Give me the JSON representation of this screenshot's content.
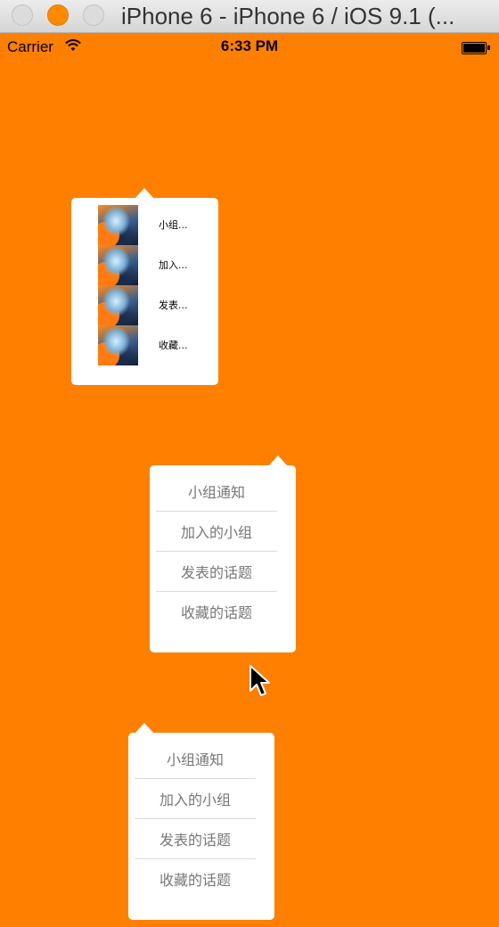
{
  "window": {
    "title": "iPhone 6 - iPhone 6 / iOS 9.1 (..."
  },
  "statusbar": {
    "carrier": "Carrier",
    "time": "6:33 PM",
    "wifi_icon": "wifi-icon",
    "battery_icon": "battery-icon"
  },
  "colors": {
    "background": "#ff7f00",
    "popover": "#ffffff",
    "menu_text": "#777777"
  },
  "icon_menu": {
    "items": [
      {
        "label": "小组...",
        "icon": "group-thumbnail-icon"
      },
      {
        "label": "加入...",
        "icon": "group-thumbnail-icon"
      },
      {
        "label": "发表...",
        "icon": "group-thumbnail-icon"
      },
      {
        "label": "收藏...",
        "icon": "group-thumbnail-icon"
      }
    ]
  },
  "text_menu_a": {
    "items": [
      {
        "label": "小组通知"
      },
      {
        "label": "加入的小组"
      },
      {
        "label": "发表的话题"
      },
      {
        "label": "收藏的话题"
      }
    ]
  },
  "text_menu_b": {
    "items": [
      {
        "label": "小组通知"
      },
      {
        "label": "加入的小组"
      },
      {
        "label": "发表的话题"
      },
      {
        "label": "收藏的话题"
      }
    ]
  }
}
